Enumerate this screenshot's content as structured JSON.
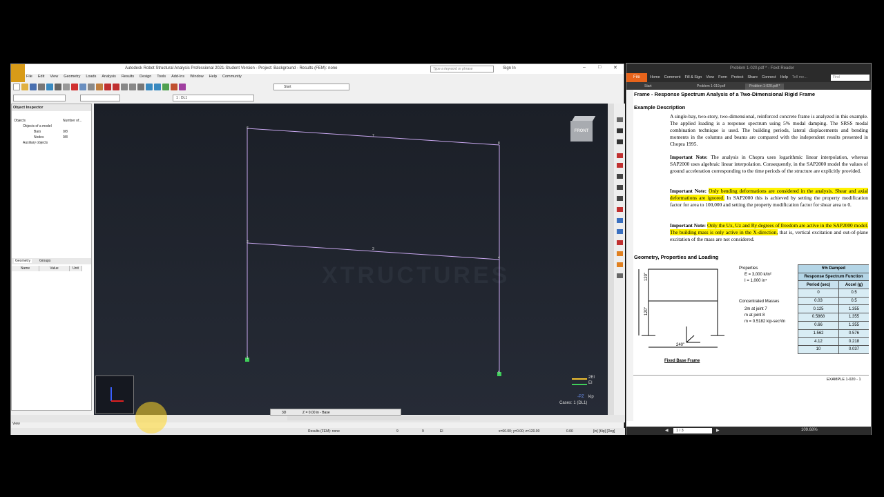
{
  "robot": {
    "title": "Autodesk Robot Structural Analysis Professional 2021-Student Version - Project: Background - Results (FEM): none",
    "search_placeholder": "Type a keyword or phrase",
    "sign_in": "Sign In",
    "menu": [
      "File",
      "Edit",
      "View",
      "Geometry",
      "Loads",
      "Analysis",
      "Results",
      "Design",
      "Tools",
      "Add-Ins",
      "Window",
      "Help",
      "Community"
    ],
    "start_select": "Start",
    "case_select": "1 : DL1",
    "inspector": {
      "title": "Object Inspector",
      "col_objects": "Objects",
      "col_number": "Number of...",
      "tree_root": "Objects of a model",
      "bars_label": "Bars",
      "bars_count": "0/8",
      "nodes_label": "Nodes",
      "nodes_count": "0/8",
      "auxiliary": "Auxiliary objects",
      "tab_geometry": "Geometry",
      "tab_groups": "Groups",
      "prop_name": "Name",
      "prop_value": "Value",
      "prop_unit": "Unit"
    },
    "viewcube": "FRONT",
    "watermark": "XTRUCTURES",
    "legend": {
      "item1": "2EI",
      "item2": "EI",
      "color1": "#f2c230",
      "color2": "#3fcf5a"
    },
    "view_info": {
      "axis": "-PZ",
      "unit": "kip",
      "cases": "Cases: 1 (DL1)"
    },
    "nodes": [
      "1",
      "2",
      "3",
      "4",
      "5",
      "6",
      "7",
      "8"
    ],
    "view_mode": "3D",
    "level": "Z = 0.00 in - Base",
    "status_bar": {
      "view": "View",
      "results": "Results (FEM): none",
      "n1": "9",
      "n2": "9",
      "n3": "El",
      "coords": "x=60.00; y=0.00; z=120.00",
      "value": "0.00",
      "units": "[in] [Kip] [Deg]"
    }
  },
  "foxit": {
    "title": "Problem 1-020.pdf * - Foxit Reader",
    "file_btn": "File",
    "menu": [
      "Home",
      "Comment",
      "Fill & Sign",
      "View",
      "Form",
      "Protect",
      "Share",
      "Connect",
      "Help"
    ],
    "tell_me": "Tell me...",
    "find": "Find",
    "tabs": [
      "Start",
      "Problem 1-019.pdf",
      "Problem 1-020.pdf *"
    ],
    "page_box": "1 / 3",
    "zoom": "109.68%",
    "page": {
      "title": "Frame - Response Spectrum Analysis of a Two-Dimensional Rigid Frame",
      "h_example": "Example Description",
      "p1": "A single-bay, two-story, two-dimensional, reinforced concrete frame is analyzed in this example. The applied loading is a response spectrum using 5% modal damping. The SRSS modal combination technique is used. The building periods, lateral displacements and bending moments in the columns and beams are compared with the independent results presented in Chopra 1995.",
      "note_label": "Important Note:",
      "p2": "The analysis in Chopra uses logarithmic linear interpolation, whereas SAP2000 uses algebraic linear interpolation. Consequently, in the SAP2000 model the values of ground acceleration corresponding to the time periods of the structure are explicitly provided.",
      "p3_hl": "Only bending deformations are considered in the analysis. Shear and axial deformations are ignored.",
      "p3_rest": "In SAP2000 this is achieved by setting the property modification factor for area to 100,000 and setting the property modification factor for shear area to 0.",
      "p4_hl": "Only the Ux, Uz and Ry degrees of freedom are active in the SAP2000 model. The building mass is only active in the X-direction,",
      "p4_rest": "that is, vertical excitation and out-of-plane excitation of the mass are not considered.",
      "h_geometry": "Geometry, Properties and Loading",
      "properties": "Properties",
      "prop_E": "E = 3,000 k/in²",
      "prop_I": "I = 1,000 in⁴",
      "masses": "Concentrated Masses",
      "mass1": "2m at joint 7",
      "mass2": "m at joint 8",
      "mass3": "m = 0.5182 kip-sec²/in",
      "fig_caption": "Fixed Base Frame",
      "fig_width": "240\"",
      "fig_h1": "120\"",
      "fig_h2": "120\"",
      "footer": "EXAMPLE 1-020 - 1",
      "table": {
        "h1": "5% Damped",
        "h2": "Response Spectrum Function",
        "col1": "Period (sec)",
        "col2": "Accel (g)",
        "rows": [
          [
            "0",
            "0.5"
          ],
          [
            "0.03",
            "0.5"
          ],
          [
            "0.125",
            "1.355"
          ],
          [
            "0.5868",
            "1.355"
          ],
          [
            "0.66",
            "1.355"
          ],
          [
            "1.562",
            "0.576"
          ],
          [
            "4.12",
            "0.218"
          ],
          [
            "10",
            "0.037"
          ]
        ]
      }
    }
  }
}
